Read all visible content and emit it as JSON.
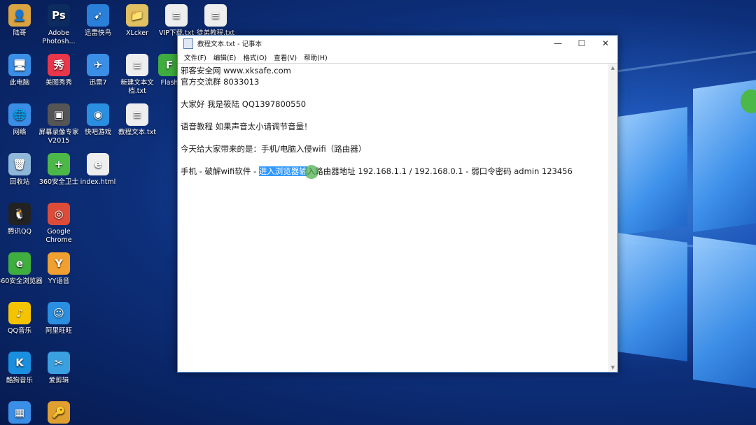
{
  "desktop": {
    "icons": [
      {
        "label": "陆哥",
        "color": "#d9a441",
        "glyph": "👤"
      },
      {
        "label": "Adobe Photosh...",
        "color": "#0c2b5e",
        "glyph": "Ps"
      },
      {
        "label": "迅雷快鸟",
        "color": "#2a7fd8",
        "glyph": "➹"
      },
      {
        "label": "XLcker",
        "color": "#e0c060",
        "glyph": "📁"
      },
      {
        "label": "VIP下载.txt",
        "color": "#eeeeee",
        "glyph": "≡"
      },
      {
        "label": "徒弟教程.txt",
        "color": "#eeeeee",
        "glyph": "≡"
      },
      {
        "label": "此电脑",
        "color": "#3a8ee6",
        "glyph": "🖥"
      },
      {
        "label": "美图秀秀",
        "color": "#e8364a",
        "glyph": "秀"
      },
      {
        "label": "迅雷7",
        "color": "#3a8ee6",
        "glyph": "✈"
      },
      {
        "label": "新建文本文档.txt",
        "color": "#eeeeee",
        "glyph": "≡"
      },
      {
        "label": "Flash",
        "color": "#3fae3f",
        "glyph": "F"
      },
      {
        "label": "网络",
        "color": "#3a8ee6",
        "glyph": "🌐"
      },
      {
        "label": "屏幕录像专家V2015",
        "color": "#555555",
        "glyph": "▣"
      },
      {
        "label": "快吧游戏",
        "color": "#2a8fe0",
        "glyph": "◉"
      },
      {
        "label": "教程文本.txt",
        "color": "#eeeeee",
        "glyph": "≡"
      },
      {
        "label": "回收站",
        "color": "#8fb7d9",
        "glyph": "🗑"
      },
      {
        "label": "360安全卫士",
        "color": "#4cb848",
        "glyph": "+"
      },
      {
        "label": "index.html",
        "color": "#eeeeee",
        "glyph": "e"
      },
      {
        "label": "腾讯QQ",
        "color": "#222222",
        "glyph": "🐧"
      },
      {
        "label": "Google Chrome",
        "color": "#dd4b39",
        "glyph": "◎"
      },
      {
        "label": "360安全浏览器",
        "color": "#3fae3f",
        "glyph": "e"
      },
      {
        "label": "YY语音",
        "color": "#f0a030",
        "glyph": "Y"
      },
      {
        "label": "QQ音乐",
        "color": "#f5c400",
        "glyph": "♪"
      },
      {
        "label": "阿里旺旺",
        "color": "#2a8fe0",
        "glyph": "☺"
      },
      {
        "label": "酷狗音乐",
        "color": "#1a8fe0",
        "glyph": "K"
      },
      {
        "label": "爱剪辑",
        "color": "#3aa0e0",
        "glyph": "✂"
      },
      {
        "label": "",
        "color": "#3a8ee6",
        "glyph": "▦"
      },
      {
        "label": "",
        "color": "#e0a030",
        "glyph": "🔑"
      }
    ]
  },
  "notepad": {
    "title": "教程文本.txt - 记事本",
    "window_buttons": {
      "minimize": "—",
      "maximize": "☐",
      "close": "✕"
    },
    "menu": [
      "文件(F)",
      "编辑(E)",
      "格式(O)",
      "查看(V)",
      "帮助(H)"
    ],
    "lines": {
      "l1": "邪客安全网 www.xksafe.com",
      "l2": "官方交流群 8033013",
      "l3": "大家好 我是筱陆 QQ1397800550",
      "l4": "语音教程 如果声音太小请调节音量！",
      "l5": "今天给大家带来的是：手机/电脑入侵wifi（路由器）",
      "l6_pre": "手机 - 破解wifi软件 - ",
      "l6_sel": "进入浏览器输",
      "l6_post": "入路由器地址 192.168.1.1 / 192.168.0.1 - 弱口令密码 admin 123456"
    },
    "scroll": {
      "up": "▲",
      "down": "▼"
    }
  }
}
